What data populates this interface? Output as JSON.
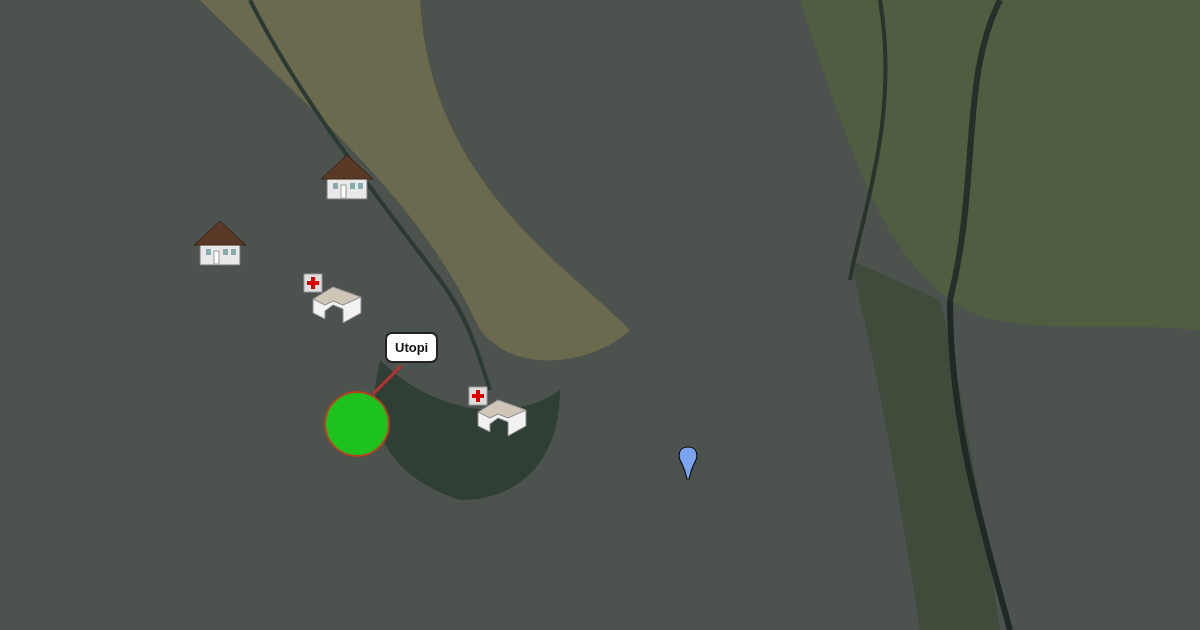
{
  "map": {
    "markers": [
      {
        "kind": "house"
      },
      {
        "kind": "house"
      },
      {
        "kind": "hospital"
      },
      {
        "kind": "hospital"
      },
      {
        "kind": "circle",
        "label": "Utopi"
      },
      {
        "kind": "pin"
      }
    ]
  }
}
